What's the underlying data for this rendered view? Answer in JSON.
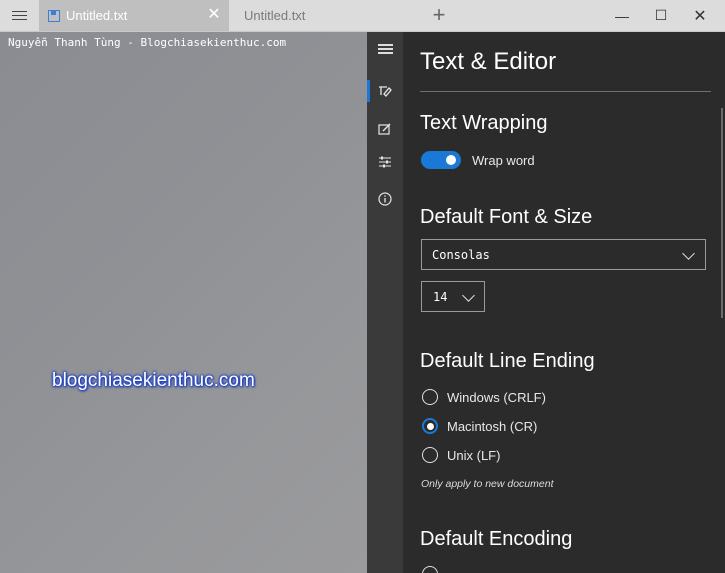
{
  "titlebar": {
    "tabs": [
      {
        "label": "Untitled.txt",
        "active": true
      },
      {
        "label": "Untitled.txt",
        "active": false
      }
    ]
  },
  "editor": {
    "content": "Nguyễn Thanh Tùng - Blogchiasekienthuc.com",
    "watermark": "blogchiasekienthuc.com"
  },
  "settings": {
    "title": "Text & Editor",
    "text_wrapping": {
      "heading": "Text Wrapping",
      "toggle_label": "Wrap word",
      "enabled": true
    },
    "font": {
      "heading": "Default Font & Size",
      "family": "Consolas",
      "size": "14"
    },
    "line_ending": {
      "heading": "Default Line Ending",
      "options": [
        {
          "label": "Windows (CRLF)",
          "selected": false
        },
        {
          "label": "Macintosh (CR)",
          "selected": true
        },
        {
          "label": "Unix (LF)",
          "selected": false
        }
      ],
      "note": "Only apply to new document"
    },
    "encoding": {
      "heading": "Default Encoding"
    }
  },
  "colors": {
    "accent": "#1a79d6",
    "panel_bg": "#2b2b2b",
    "rail_bg": "#3a3a3a"
  }
}
